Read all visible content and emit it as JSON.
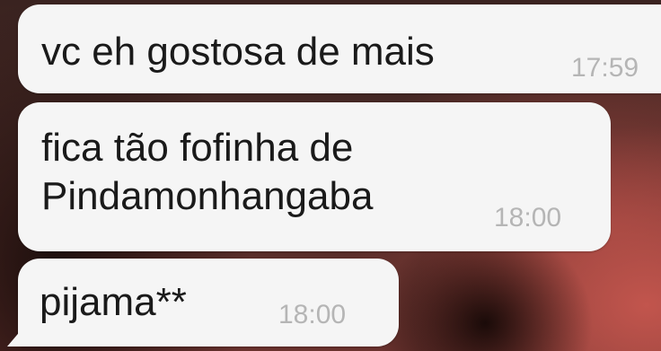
{
  "conversation": {
    "messages": [
      {
        "text": "vc eh gostosa de mais",
        "time": "17:59"
      },
      {
        "text": "fica tão fofinha de\nPindamonhangaba",
        "time": "18:00"
      },
      {
        "text": "pijama**",
        "time": "18:00"
      }
    ]
  },
  "colors": {
    "bubble": "#f5f5f5",
    "text": "#1a1a1a",
    "timestamp": "#b5b5b5"
  }
}
